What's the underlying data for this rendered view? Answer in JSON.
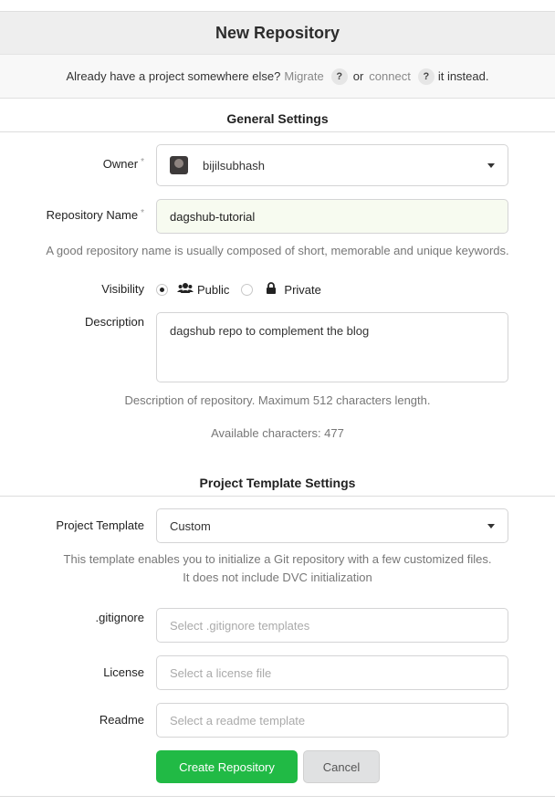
{
  "header": {
    "title": "New Repository"
  },
  "migrate": {
    "prefix": "Already have a project somewhere else?",
    "migrate_link": "Migrate",
    "help": "?",
    "or": "or",
    "connect_link": "connect",
    "suffix": "it instead."
  },
  "general": {
    "heading": "General Settings",
    "owner": {
      "label": "Owner",
      "required_mark": "*",
      "value": "bijilsubhash"
    },
    "repo_name": {
      "label": "Repository Name",
      "required_mark": "*",
      "value": "dagshub-tutorial",
      "hint": "A good repository name is usually composed of short, memorable and unique keywords."
    },
    "visibility": {
      "label": "Visibility",
      "public_label": "Public",
      "private_label": "Private",
      "selected": "Public"
    },
    "description": {
      "label": "Description",
      "value": "dagshub repo to complement the blog",
      "hint": "Description of repository. Maximum 512 characters length.",
      "available": "Available characters: 477"
    }
  },
  "template": {
    "heading": "Project Template Settings",
    "project_template": {
      "label": "Project Template",
      "value": "Custom"
    },
    "hint_line1": "This template enables you to initialize a Git repository with a few customized files.",
    "hint_line2": "It does not include DVC initialization",
    "gitignore": {
      "label": ".gitignore",
      "placeholder": "Select .gitignore templates"
    },
    "license": {
      "label": "License",
      "placeholder": "Select a license file"
    },
    "readme": {
      "label": "Readme",
      "placeholder": "Select a readme template"
    }
  },
  "actions": {
    "create_label": "Create Repository",
    "cancel_label": "Cancel"
  },
  "colors": {
    "accent_green": "#21ba45",
    "title_bg": "#eeeeee"
  },
  "icons": {
    "owner_caret": "caret-down-icon",
    "public": "users-icon",
    "private": "lock-icon",
    "help": "question-icon"
  }
}
